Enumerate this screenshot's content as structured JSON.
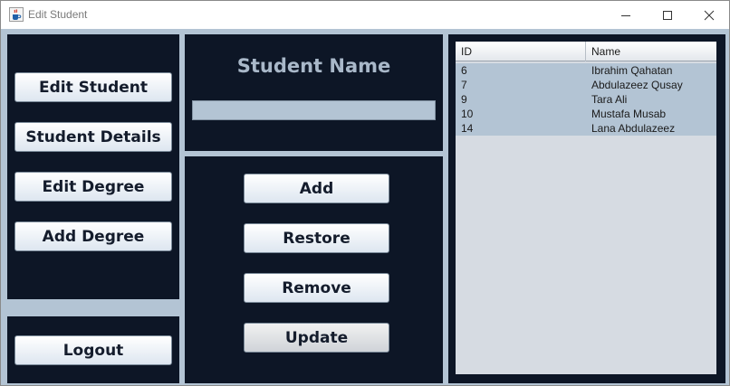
{
  "window": {
    "title": "Edit Student"
  },
  "sidebar": {
    "edit_student": "Edit Student",
    "student_details": "Student Details",
    "edit_degree": "Edit Degree",
    "add_degree": "Add Degree",
    "logout": "Logout"
  },
  "form": {
    "title": "Student Name",
    "name_value": ""
  },
  "actions": {
    "add": "Add",
    "restore": "Restore",
    "remove": "Remove",
    "update": "Update"
  },
  "table": {
    "columns": [
      "ID",
      "Name"
    ],
    "rows": [
      {
        "id": "6",
        "name": "Ibrahim Qahatan"
      },
      {
        "id": "7",
        "name": "Abdulazeez Qusay"
      },
      {
        "id": "9",
        "name": "Tara Ali"
      },
      {
        "id": "10",
        "name": "Mustafa Musab"
      },
      {
        "id": "14",
        "name": "Lana Abdulazeez"
      }
    ]
  },
  "colors": {
    "background": "#b3c4d4",
    "panel": "#0d1626",
    "title_accent": "#a9b8c9",
    "selected_row": "#b3c4d4"
  },
  "icons": {
    "app": "java-coffee-cup-icon",
    "minimize": "minimize-icon",
    "maximize": "maximize-icon",
    "close": "close-icon"
  }
}
